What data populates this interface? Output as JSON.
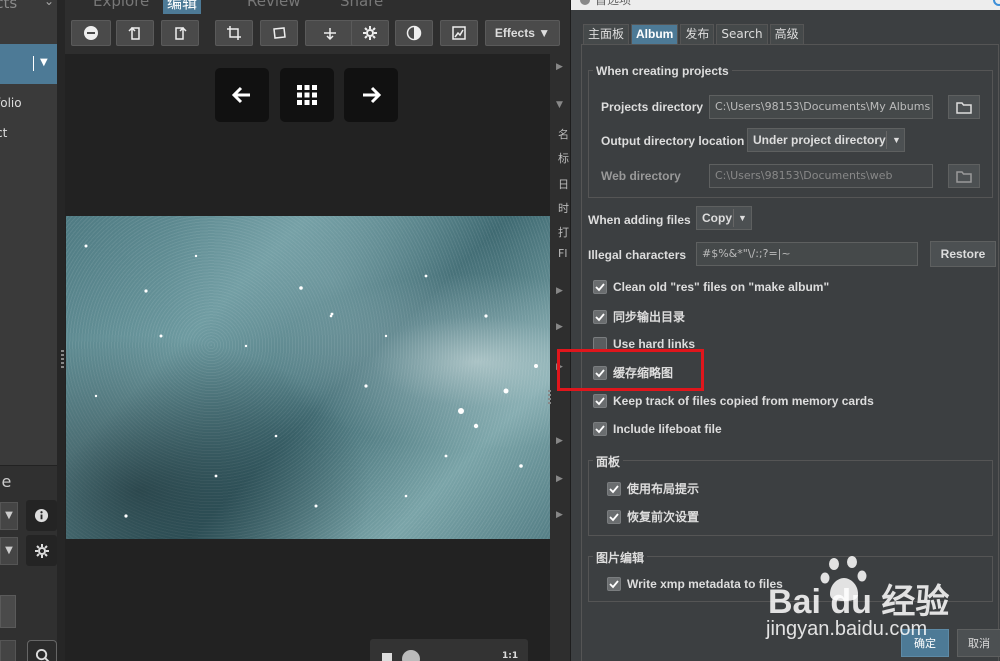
{
  "left_sidebar": {
    "header_text": "ects",
    "items": [
      "folio",
      "ct"
    ],
    "panel_label": "le"
  },
  "top_tabs": [
    {
      "label": "Explore",
      "active": false
    },
    {
      "label": "编辑",
      "active": true
    },
    {
      "label": "Review",
      "active": false
    },
    {
      "label": "Share",
      "active": false
    }
  ],
  "toolbar": {
    "buttons": [
      "minus-circle-icon",
      "rotate-left-icon",
      "rotate-right-icon",
      "crop-icon",
      "straighten-icon",
      "level-icon",
      "gear-icon",
      "contrast-icon",
      "image-edit-icon"
    ],
    "effects_label": "Effects"
  },
  "viewer": {
    "nav": [
      "arrow-left-icon",
      "grid-icon",
      "arrow-right-icon"
    ],
    "zoom_ratio": "1:1"
  },
  "info_strip": {
    "labels": [
      "名",
      "标",
      "日",
      "时",
      "打",
      "Fl"
    ]
  },
  "dialog": {
    "title": "首选项",
    "tabs": [
      {
        "label": "主面板",
        "active": false
      },
      {
        "label": "Album",
        "active": true
      },
      {
        "label": "发布",
        "active": false
      },
      {
        "label": "Search",
        "active": false
      },
      {
        "label": "高级",
        "active": false
      }
    ],
    "creating_group": {
      "title": "When creating projects",
      "projects_directory_label": "Projects directory",
      "projects_directory_value": "C:\\Users\\98153\\Documents\\My Albums",
      "output_location_label": "Output directory location",
      "output_location_value": "Under project directory",
      "web_directory_label": "Web directory",
      "web_directory_value": "C:\\Users\\98153\\Documents\\web"
    },
    "adding_files_label": "When adding files",
    "adding_files_value": "Copy",
    "illegal_chars_label": "Illegal characters",
    "illegal_chars_value": "#$%&*\"\\/:;?=|~",
    "restore_label": "Restore",
    "checkboxes": [
      {
        "label": "Clean old \"res\" files on \"make album\"",
        "checked": true
      },
      {
        "label": "同步输出目录",
        "checked": true
      },
      {
        "label": "Use hard links",
        "checked": false
      },
      {
        "label": "缓存缩略图",
        "checked": true
      },
      {
        "label": "Keep track of files copied from memory cards",
        "checked": true
      },
      {
        "label": "Include lifeboat file",
        "checked": true
      }
    ],
    "panel_group": {
      "title": "面板",
      "checkboxes": [
        {
          "label": "使用布局提示",
          "checked": true
        },
        {
          "label": "恢复前次设置",
          "checked": true
        }
      ]
    },
    "image_edit_group": {
      "title": "图片编辑",
      "checkboxes": [
        {
          "label": "Write xmp metadata to files",
          "checked": true
        }
      ]
    },
    "ok_label": "确定",
    "cancel_label": "取消"
  },
  "watermark": {
    "text": "Bai du 经验",
    "url": "jingyan.baidu.com"
  },
  "colors": {
    "accent": "#4d7a96",
    "highlight": "#e0161c",
    "dialog_bg": "#3c3f41"
  }
}
